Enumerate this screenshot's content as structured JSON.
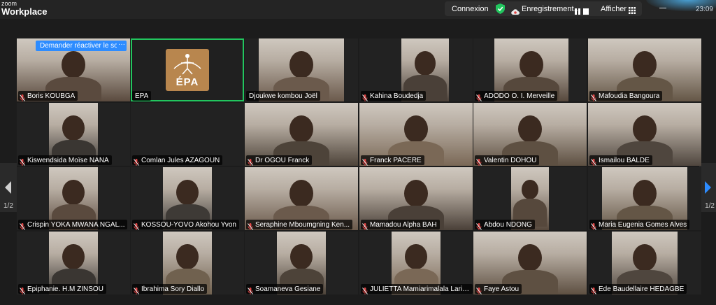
{
  "app": {
    "brand_small": "zoom",
    "brand_big": "Workplace"
  },
  "toolbar": {
    "connexion": "Connexion",
    "recording": "Enregistrement...",
    "view": "Afficher"
  },
  "clock": "23:09",
  "pager": {
    "left": "1/2",
    "right": "1/2"
  },
  "colors": {
    "active_speaker": "#22c55e",
    "accent": "#2d8cff",
    "muted_mic": "#e04545"
  },
  "first_tile": {
    "request_button": "Demander réactiver le son",
    "more_button": "···"
  },
  "epa_logo_text": "ÉPA",
  "participants": [
    {
      "name": "Boris KOUBGA",
      "muted": true
    },
    {
      "name": "EPA",
      "muted": false,
      "active": true
    },
    {
      "name": "Djoukwe kombou Joël",
      "muted": false
    },
    {
      "name": "Kahina Boudedja",
      "muted": true
    },
    {
      "name": "ADODO O. I. Merveille",
      "muted": true
    },
    {
      "name": "Mafoudia Bangoura",
      "muted": true
    },
    {
      "name": "Kiswendsida Moïse NANA",
      "muted": true
    },
    {
      "name": "Comlan Jules AZAGOUN",
      "muted": true
    },
    {
      "name": "Dr OGOU Franck",
      "muted": true
    },
    {
      "name": "Franck PACERE",
      "muted": true
    },
    {
      "name": "Valentin DOHOU",
      "muted": true
    },
    {
      "name": "Ismailou BALDE",
      "muted": true
    },
    {
      "name": "Crispin YOKA MWANA NGAL...",
      "muted": true
    },
    {
      "name": "KOSSOU-YOVO Akohou Yvon",
      "muted": true
    },
    {
      "name": "Seraphine Mboumgning Ken...",
      "muted": true
    },
    {
      "name": "Mamadou Alpha BAH",
      "muted": true
    },
    {
      "name": "Abdou NDONG",
      "muted": true
    },
    {
      "name": "Maria Eugenia Gomes Alves",
      "muted": true
    },
    {
      "name": "Epiphanie. H.M ZINSOU",
      "muted": true
    },
    {
      "name": "Ibrahima Sory Diallo",
      "muted": true
    },
    {
      "name": "Soamaneva Gesiane",
      "muted": true
    },
    {
      "name": "JULIETTA Mamiarimalala Laris...",
      "muted": true
    },
    {
      "name": "Faye Astou",
      "muted": true
    },
    {
      "name": "Ede Baudellaire HEDAGBE",
      "muted": true
    }
  ]
}
